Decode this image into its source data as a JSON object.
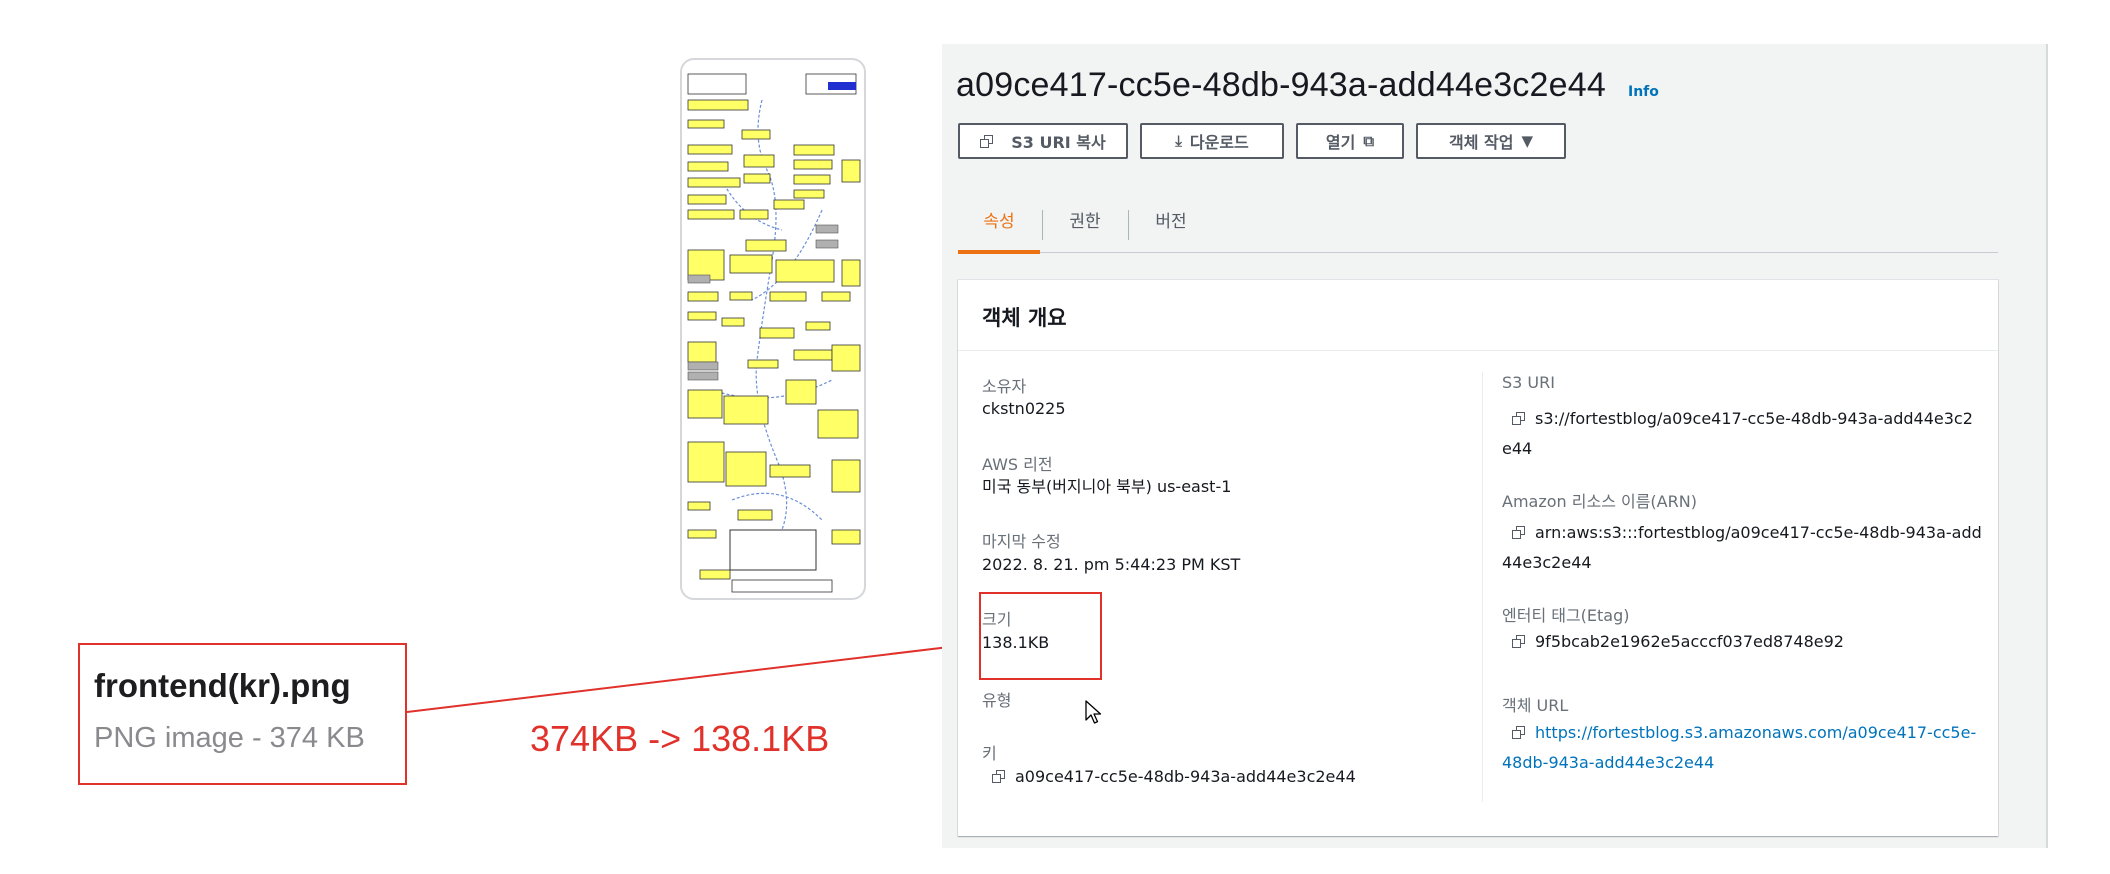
{
  "annotation": {
    "file_name": "frontend(kr).png",
    "file_info": "PNG image - 374 KB",
    "size_change": "374KB -> 138.1KB"
  },
  "object": {
    "title": "a09ce417-cc5e-48db-943a-add44e3c2e44",
    "info_label": "Info"
  },
  "toolbar": {
    "copy_uri_label": "S3 URI 복사",
    "download_label": "다운로드",
    "open_label": "열기",
    "actions_label": "객체 작업"
  },
  "tabs": [
    {
      "label": "속성",
      "active": true
    },
    {
      "label": "권한",
      "active": false
    },
    {
      "label": "버전",
      "active": false
    }
  ],
  "overview": {
    "title": "객체 개요",
    "owner_label": "소유자",
    "owner_value": "ckstn0225",
    "region_label": "AWS 리전",
    "region_value": "미국 동부(버지니아 북부) us-east-1",
    "modified_label": "마지막 수정",
    "modified_value": "2022. 8. 21. pm 5:44:23 PM KST",
    "size_label": "크기",
    "size_value": "138.1KB",
    "type_label": "유형",
    "key_label": "키",
    "key_value": "a09ce417-cc5e-48db-943a-add44e3c2e44",
    "s3uri_label": "S3 URI",
    "s3uri_value_line1": "s3://fortestblog/a09ce417-cc5e-48db-943a-add44e3c2",
    "s3uri_value_line2": "e44",
    "arn_label": "Amazon 리소스 이름(ARN)",
    "arn_value_line1": "arn:aws:s3:::fortestblog/a09ce417-cc5e-48db-943a-add",
    "arn_value_line2": "44e3c2e44",
    "etag_label": "엔터티 태그(Etag)",
    "etag_value": "9f5bcab2e1962e5acccf037ed8748e92",
    "url_label": "객체 URL",
    "url_value_line1": "https://fortestblog.s3.amazonaws.com/a09ce417-cc5e-",
    "url_value_line2": "48db-943a-add44e3c2e44"
  },
  "colors": {
    "accent_orange": "#ec7211",
    "link_blue": "#0073bb",
    "annotation_red": "#e0312b",
    "diagram_yellow": "#ffff66"
  }
}
